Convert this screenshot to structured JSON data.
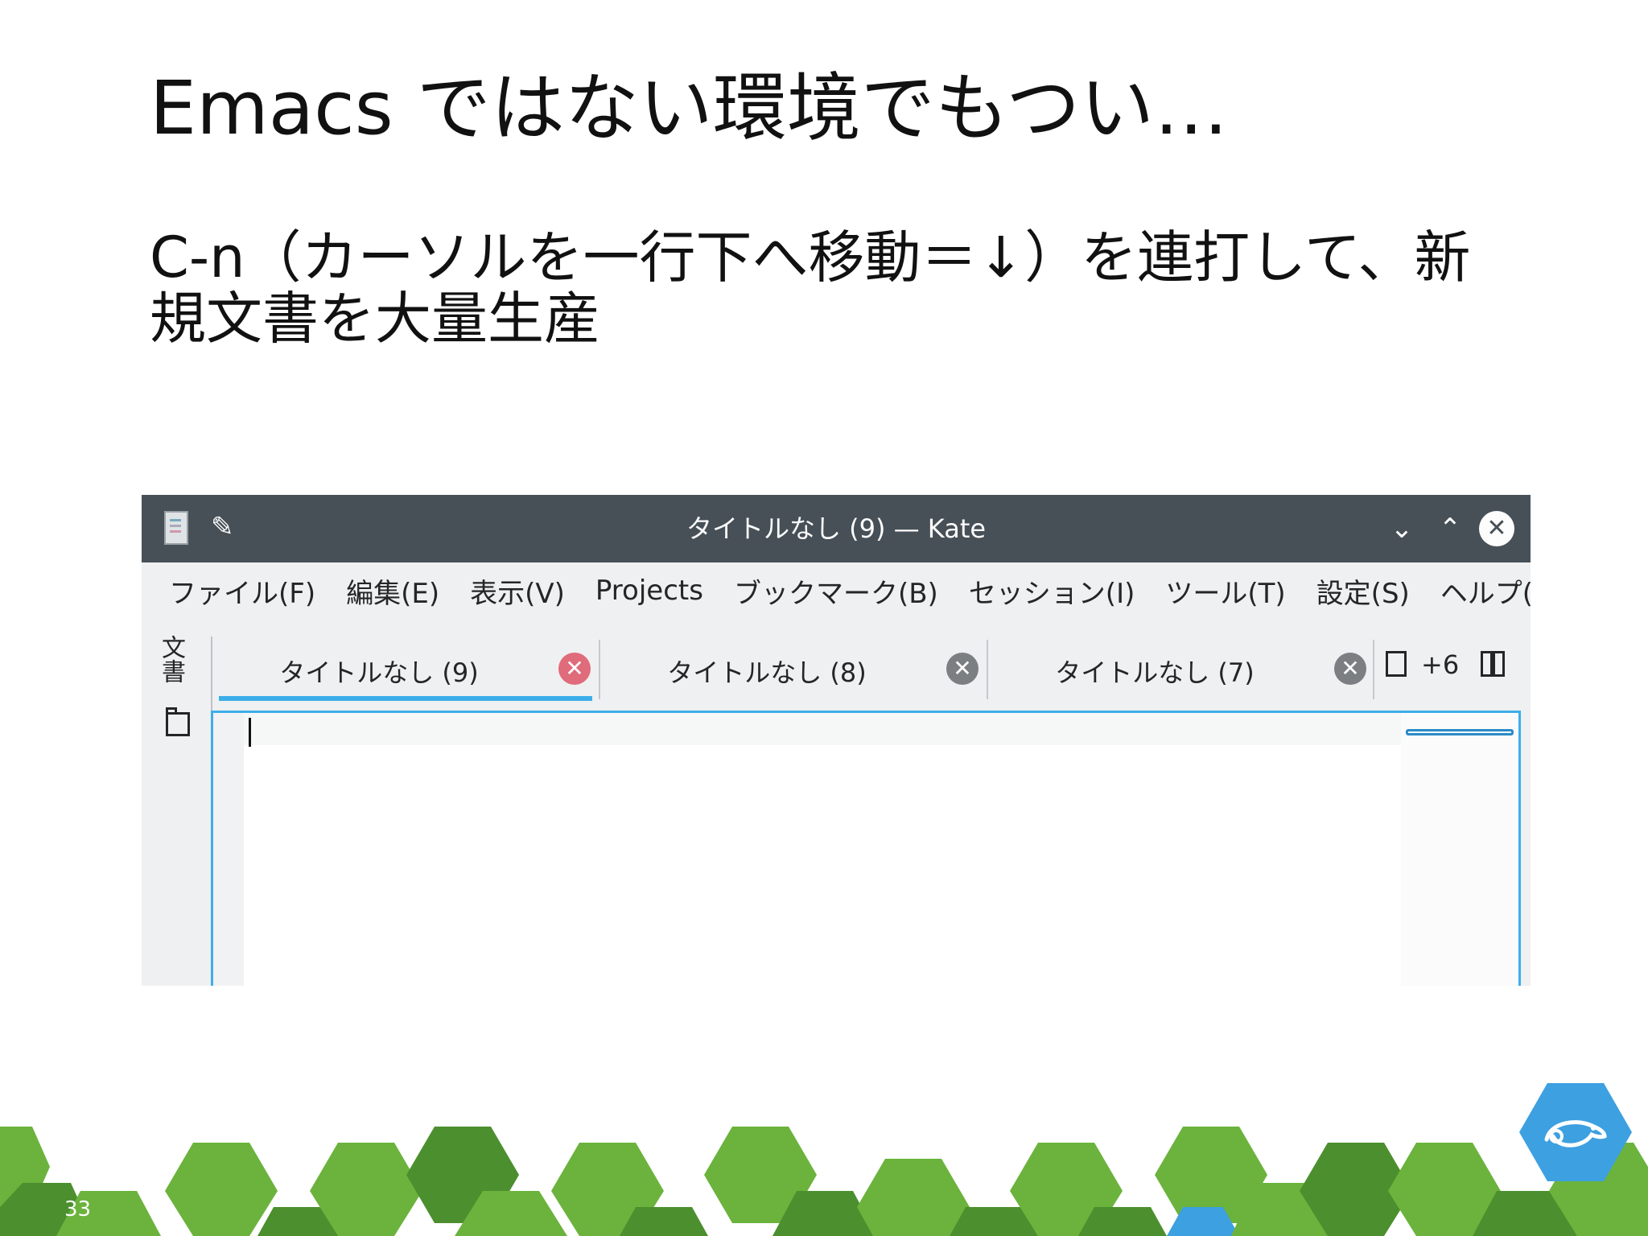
{
  "slide": {
    "title": "Emacs ではない環境でもつい…",
    "body": "C-n（カーソルを一行下へ移動＝↓）を連打して、新規文書を大量生産",
    "page_number": "33"
  },
  "kate": {
    "window_title": "タイトルなし (9) — Kate",
    "menu": [
      "ファイル(F)",
      "編集(E)",
      "表示(V)",
      "Projects",
      "ブックマーク(B)",
      "セッション(I)",
      "ツール(T)",
      "設定(S)",
      "ヘルプ(H)"
    ],
    "sidebar_tab": "文書",
    "tabs": [
      {
        "label": "タイトルなし (9)",
        "active": true
      },
      {
        "label": "タイトルなし (8)",
        "active": false
      },
      {
        "label": "タイトルなし (7)",
        "active": false
      }
    ],
    "more_tabs": "+6"
  },
  "colors": {
    "titlebar": "#475057",
    "accent": "#3daee9",
    "hex_green_dark": "#4c8f2e",
    "hex_green": "#6bb33c",
    "logo_blue": "#3da0e0"
  },
  "icons": {
    "app": "kate-app-icon",
    "pin": "pin-icon",
    "minimize": "chevron-down-icon",
    "maximize": "chevron-up-icon",
    "close": "close-icon",
    "folder": "folder-icon",
    "new_tab": "new-document-icon",
    "split": "split-view-icon",
    "logo": "chameleon-logo-icon"
  }
}
